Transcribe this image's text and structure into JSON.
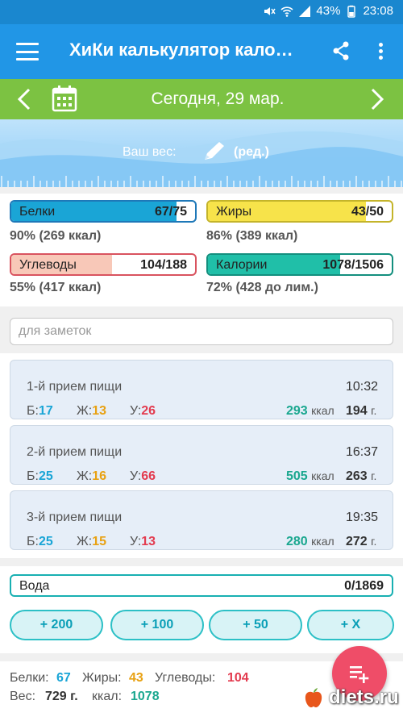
{
  "status_bar": {
    "battery": "43%",
    "time": "23:08"
  },
  "app_bar": {
    "title": "ХиКи калькулятор кало…"
  },
  "date_bar": {
    "date": "Сегодня, 29 мар."
  },
  "weight": {
    "label": "Ваш вес:",
    "edit_label": "(ред.)"
  },
  "macros": {
    "protein": {
      "name": "Белки",
      "value": "67/75",
      "sub": "90% (269 ккал)",
      "fill_pct": 90,
      "color": "#1aa5d6"
    },
    "fat": {
      "name": "Жиры",
      "value": "43/50",
      "sub": "86% (389 ккал)",
      "fill_pct": 86,
      "color": "#f7e34a"
    },
    "carbs": {
      "name": "Углеводы",
      "value": "104/188",
      "sub": "55% (417 ккал)",
      "fill_pct": 55,
      "color": "#f8c8b8"
    },
    "calories": {
      "name": "Калории",
      "value": "1078/1506",
      "sub": "72% (428 до лим.)",
      "fill_pct": 72,
      "color": "#20bfa8"
    }
  },
  "notes": {
    "placeholder": "для заметок"
  },
  "meals": [
    {
      "name": "1-й прием пищи",
      "time": "10:32",
      "b_label": "Б:",
      "b": "17",
      "z_label": "Ж:",
      "z": "13",
      "u_label": "У:",
      "u": "26",
      "kcal": "293",
      "kcal_unit": "ккал",
      "grams": "194",
      "grams_unit": "г."
    },
    {
      "name": "2-й прием пищи",
      "time": "16:37",
      "b_label": "Б:",
      "b": "25",
      "z_label": "Ж:",
      "z": "16",
      "u_label": "У:",
      "u": "66",
      "kcal": "505",
      "kcal_unit": "ккал",
      "grams": "263",
      "grams_unit": "г."
    },
    {
      "name": "3-й прием пищи",
      "time": "19:35",
      "b_label": "Б:",
      "b": "25",
      "z_label": "Ж:",
      "z": "15",
      "u_label": "У:",
      "u": "13",
      "kcal": "280",
      "kcal_unit": "ккал",
      "grams": "272",
      "grams_unit": "г."
    }
  ],
  "water": {
    "name": "Вода",
    "value": "0/1869",
    "buttons": [
      "+ 200",
      "+ 100",
      "+ 50",
      "+ X"
    ]
  },
  "summary": {
    "protein_label": "Белки:",
    "protein": "67",
    "fat_label": "Жиры:",
    "fat": "43",
    "carbs_label": "Углеводы:",
    "carbs": "104",
    "weight_label": "Вес:",
    "weight": "729 г.",
    "kcal_label": "ккал:",
    "kcal": "1078"
  },
  "watermark": {
    "text": "diets.ru"
  },
  "colors": {
    "app_bar": "#2196e6",
    "date_bar": "#7cc242",
    "fab": "#ef4d68",
    "water_border": "#18b0b2"
  },
  "icons": [
    "menu-icon",
    "share-icon",
    "more-icon",
    "chevron-left-icon",
    "calendar-icon",
    "chevron-right-icon",
    "pencil-icon",
    "add-food-icon"
  ]
}
